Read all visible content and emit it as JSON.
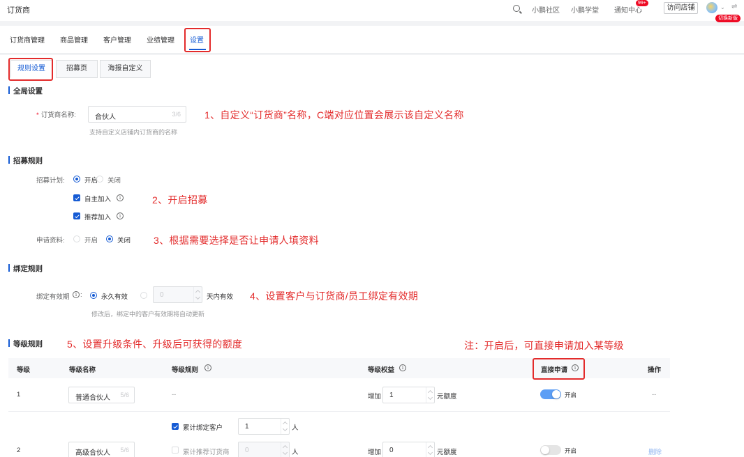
{
  "app": {
    "title": "订货商"
  },
  "topbar": {
    "community": "小鹏社区",
    "school": "小鹏学堂",
    "notify": "通知中心",
    "notify_badge": "99+",
    "visit_store": "访问店铺",
    "switch_new": "切换新版"
  },
  "nav": {
    "items": [
      "订货商管理",
      "商品管理",
      "客户管理",
      "业绩管理",
      "设置"
    ],
    "active": "设置"
  },
  "subtabs": {
    "items": [
      "规则设置",
      "招募页",
      "海报自定义"
    ],
    "active": "规则设置"
  },
  "global": {
    "title": "全局设置",
    "name_label": "订货商名称:",
    "name_value": "合伙人",
    "name_count": "3/6",
    "name_hint": "支持自定义店铺内订货商的名称"
  },
  "recruit": {
    "title": "招募规则",
    "plan_label": "招募计划:",
    "on": "开启",
    "off": "关闭",
    "self_join": "自主加入",
    "referral_join": "推荐加入",
    "apply_label": "申请资料:",
    "apply_on": "开启",
    "apply_off": "关闭"
  },
  "binding": {
    "title": "绑定规则",
    "label": "绑定有效期",
    "permanent": "永久有效",
    "days_value": "0",
    "days_suffix": "天内有效",
    "hint": "修改后，绑定中的客户有效期将自动更新"
  },
  "level": {
    "title": "等级规则",
    "headers": [
      "等级",
      "等级名称",
      "等级规则",
      "等级权益",
      "直接申请",
      "操作"
    ],
    "rows": [
      {
        "level": "1",
        "name": "普通合伙人",
        "count": "5/6",
        "rule": "--",
        "benefit_prefix": "增加",
        "benefit_value": "1",
        "benefit_suffix": "元额度",
        "switch_label": "开启",
        "op": "--"
      },
      {
        "level": "2",
        "name": "高级合伙人",
        "count": "5/6",
        "rule_a_label": "累计绑定客户",
        "rule_a_value": "1",
        "rule_a_unit": "人",
        "rule_b_label": "累计推荐订货商",
        "rule_b_value": "0",
        "rule_b_unit": "人",
        "benefit_prefix": "增加",
        "benefit_value": "0",
        "benefit_suffix": "元额度",
        "switch_label": "开启",
        "op": "删除"
      }
    ]
  },
  "annotations": {
    "a1": "1、自定义“订货商”名称，C端对应位置会展示该自定义名称",
    "a2": "2、开启招募",
    "a3": "3、根据需要选择是否让申请人填资料",
    "a4": "4、设置客户与订货商/员工绑定有效期",
    "a5": "5、设置升级条件、升级后可获得的额度",
    "note": "注：开启后，可直接申请加入某等级"
  },
  "colors": {
    "accent": "#155bd4",
    "annotation": "#e32b2b",
    "danger": "#ee0a24"
  }
}
